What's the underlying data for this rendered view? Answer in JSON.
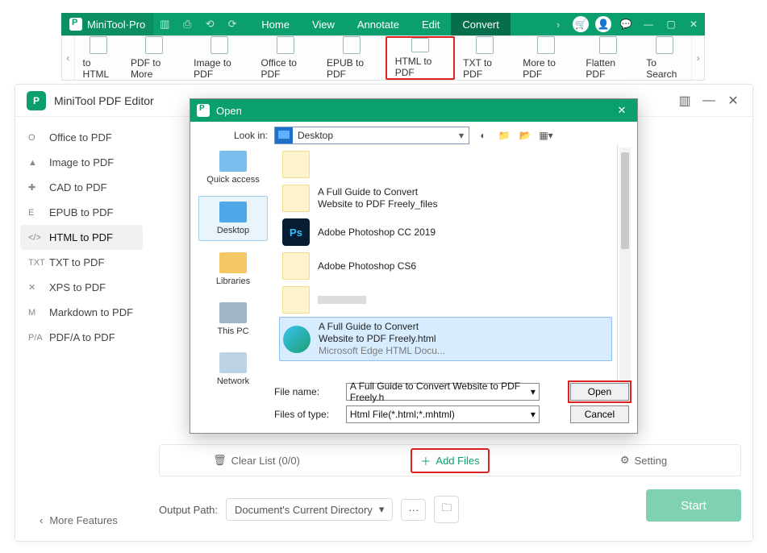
{
  "titlebar": {
    "brand": "MiniTool·Pro",
    "menu": [
      "Home",
      "View",
      "Annotate",
      "Edit",
      "Convert"
    ],
    "active_menu_index": 4
  },
  "ribbon": {
    "tools": [
      "to HTML",
      "PDF to More",
      "Image to PDF",
      "Office to PDF",
      "EPUB to PDF",
      "HTML to PDF",
      "TXT to PDF",
      "More to PDF",
      "Flatten PDF",
      "To Search"
    ],
    "highlight_index": 5
  },
  "app": {
    "title": "MiniTool PDF Editor",
    "sidebar": {
      "items": [
        {
          "icon": "O",
          "label": "Office to PDF"
        },
        {
          "icon": "▲",
          "label": "Image to PDF"
        },
        {
          "icon": "✚",
          "label": "CAD to PDF"
        },
        {
          "icon": "E",
          "label": "EPUB to PDF"
        },
        {
          "icon": "</>",
          "label": "HTML to PDF"
        },
        {
          "icon": "TXT",
          "label": "TXT to PDF"
        },
        {
          "icon": "✕",
          "label": "XPS to PDF"
        },
        {
          "icon": "M",
          "label": "Markdown to PDF"
        },
        {
          "icon": "P/A",
          "label": "PDF/A to PDF"
        }
      ],
      "selected_index": 4,
      "more": "More Features"
    },
    "listbar": {
      "clear": "Clear List (0/0)",
      "add": "Add Files",
      "setting": "Setting"
    },
    "output": {
      "label": "Output Path:",
      "value": "Document's Current Directory"
    },
    "start": "Start"
  },
  "dialog": {
    "title": "Open",
    "lookin_label": "Look in:",
    "lookin_value": "Desktop",
    "places": [
      "Quick access",
      "Desktop",
      "Libraries",
      "This PC",
      "Network"
    ],
    "selected_place_index": 1,
    "files": [
      {
        "type": "folder",
        "line1": "",
        "line2": ""
      },
      {
        "type": "folder",
        "line1": "A Full Guide to Convert",
        "line2": "Website to PDF Freely_files"
      },
      {
        "type": "ps",
        "line1": "Adobe Photoshop CC 2019",
        "line2": ""
      },
      {
        "type": "folder",
        "line1": "Adobe Photoshop CS6",
        "line2": ""
      },
      {
        "type": "folder",
        "line1": "",
        "line2": ""
      },
      {
        "type": "edge",
        "line1": "A Full Guide to Convert",
        "line2": "Website to PDF Freely.html",
        "line3": "Microsoft Edge HTML Docu..."
      }
    ],
    "selected_file_index": 5,
    "filename_label": "File name:",
    "filename_value": "A Full Guide to Convert Website to PDF Freely.h",
    "filetype_label": "Files of type:",
    "filetype_value": "Html File(*.html;*.mhtml)",
    "open": "Open",
    "cancel": "Cancel"
  }
}
